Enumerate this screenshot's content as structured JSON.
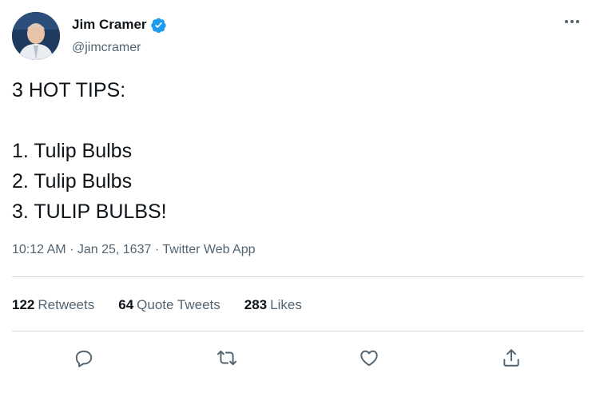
{
  "author": {
    "display_name": "Jim Cramer",
    "handle": "@jimcramer",
    "verified": true,
    "avatar_icon": "user-avatar-photo"
  },
  "tweet": {
    "lines": [
      "3 HOT TIPS:",
      "",
      "1. Tulip Bulbs",
      "2. Tulip Bulbs",
      "3. TULIP BULBS!"
    ]
  },
  "meta": {
    "time": "10:12 AM",
    "separator": "·",
    "date": "Jan 25, 1637",
    "source": "Twitter Web App"
  },
  "stats": {
    "retweets_count": "122",
    "retweets_label": "Retweets",
    "quotes_count": "64",
    "quotes_label": "Quote Tweets",
    "likes_count": "283",
    "likes_label": "Likes"
  },
  "actions": [
    "reply-icon",
    "retweet-icon",
    "like-icon",
    "share-icon"
  ],
  "colors": {
    "text_primary": "#0f1419",
    "text_secondary": "#536471",
    "divider": "#cfd9de",
    "verified_blue": "#1d9bf0"
  }
}
